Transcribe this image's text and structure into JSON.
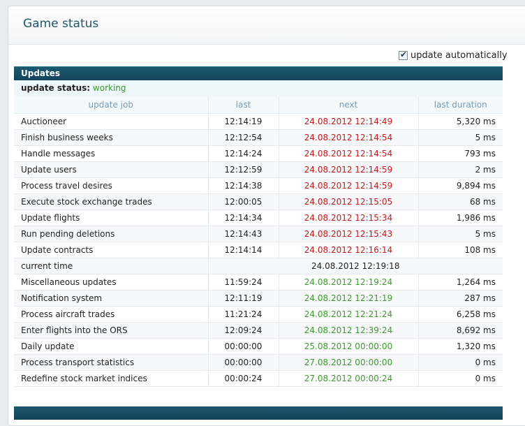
{
  "page": {
    "title": "Game status"
  },
  "auto_update": {
    "label": "update automatically",
    "checked": true
  },
  "updates": {
    "section_title": "Updates",
    "status_label": "update status:",
    "status_value": "working",
    "columns": [
      "update job",
      "last",
      "next",
      "last duration"
    ],
    "rows_before": [
      {
        "job": "Auctioneer",
        "last": "12:14:19",
        "next": "24.08.2012 12:14:49",
        "duration": "5,320 ms"
      },
      {
        "job": "Finish business weeks",
        "last": "12:12:54",
        "next": "24.08.2012 12:14:54",
        "duration": "5 ms"
      },
      {
        "job": "Handle messages",
        "last": "12:14:24",
        "next": "24.08.2012 12:14:54",
        "duration": "793 ms"
      },
      {
        "job": "Update users",
        "last": "12:12:59",
        "next": "24.08.2012 12:14:59",
        "duration": "2 ms"
      },
      {
        "job": "Process travel desires",
        "last": "12:14:38",
        "next": "24.08.2012 12:14:59",
        "duration": "9,894 ms"
      },
      {
        "job": "Execute stock exchange trades",
        "last": "12:00:05",
        "next": "24.08.2012 12:15:05",
        "duration": "68 ms"
      },
      {
        "job": "Update flights",
        "last": "12:14:34",
        "next": "24.08.2012 12:15:34",
        "duration": "1,986 ms"
      },
      {
        "job": "Run pending deletions",
        "last": "12:14:43",
        "next": "24.08.2012 12:15:43",
        "duration": "5 ms"
      },
      {
        "job": "Update contracts",
        "last": "12:14:14",
        "next": "24.08.2012 12:16:14",
        "duration": "108 ms"
      }
    ],
    "current_time_label": "current time",
    "current_time_value": "24.08.2012 12:19:18",
    "rows_after": [
      {
        "job": "Miscellaneous updates",
        "last": "11:59:24",
        "next": "24.08.2012 12:19:24",
        "duration": "1,264 ms"
      },
      {
        "job": "Notification system",
        "last": "12:11:19",
        "next": "24.08.2012 12:21:19",
        "duration": "287 ms"
      },
      {
        "job": "Process aircraft trades",
        "last": "11:21:24",
        "next": "24.08.2012 12:21:24",
        "duration": "6,258 ms"
      },
      {
        "job": "Enter flights into the ORS",
        "last": "12:09:24",
        "next": "24.08.2012 12:39:24",
        "duration": "8,692 ms"
      },
      {
        "job": "Daily update",
        "last": "00:00:00",
        "next": "25.08.2012 00:00:00",
        "duration": "1,320 ms"
      },
      {
        "job": "Process transport statistics",
        "last": "00:00:00",
        "next": "27.08.2012 00:00:00",
        "duration": "0 ms"
      },
      {
        "job": "Redefine stock market indices",
        "last": "00:00:24",
        "next": "27.08.2012 00:00:24",
        "duration": "0 ms"
      }
    ]
  },
  "colors": {
    "overdue": "#c2191c",
    "upcoming": "#3e9a2f",
    "header_bar": "#134257",
    "title": "#20566e"
  }
}
